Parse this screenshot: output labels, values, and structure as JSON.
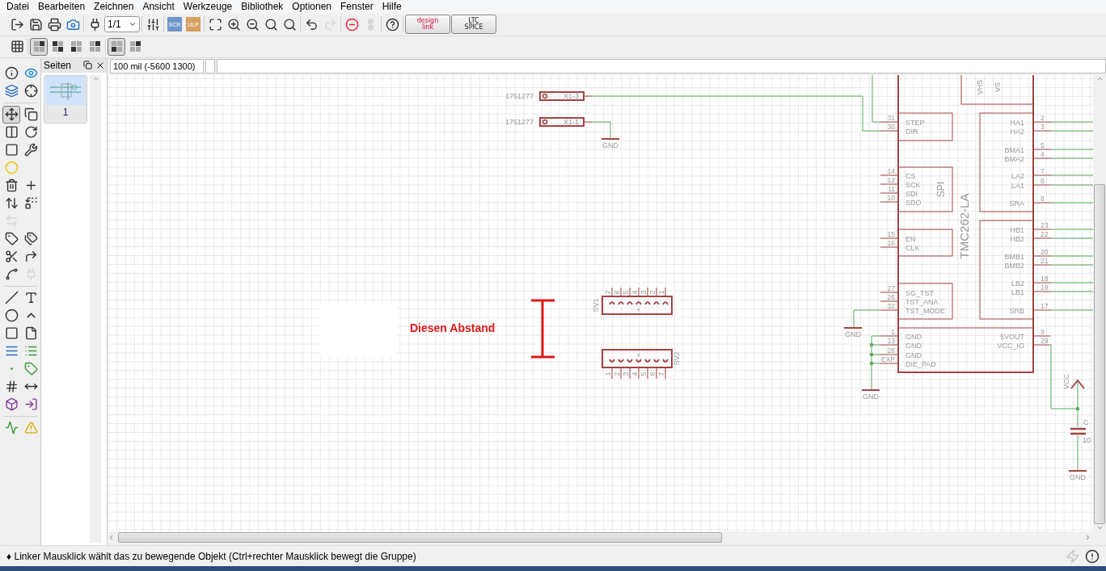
{
  "menu": [
    "Datei",
    "Bearbeiten",
    "Zeichnen",
    "Ansicht",
    "Werkzeuge",
    "Bibliothek",
    "Optionen",
    "Fenster",
    "Hilfe"
  ],
  "toolbar": [
    {
      "kind": "export",
      "disabled": false
    },
    {
      "kind": "save",
      "disabled": false
    },
    {
      "kind": "print",
      "disabled": false
    },
    {
      "kind": "camera",
      "disabled": false
    },
    {
      "kind": "sep"
    },
    {
      "kind": "board",
      "disabled": false
    },
    {
      "kind": "sheet",
      "value": "1/1",
      "disabled": false
    },
    {
      "kind": "sep"
    },
    {
      "kind": "mixer",
      "disabled": false
    },
    {
      "kind": "sep"
    },
    {
      "kind": "script",
      "label": "SCR",
      "disabled": false
    },
    {
      "kind": "ulp",
      "label": "ULP",
      "disabled": false
    },
    {
      "kind": "sep"
    },
    {
      "kind": "zoom-fit",
      "disabled": false
    },
    {
      "kind": "zoom-in",
      "disabled": false
    },
    {
      "kind": "zoom-out",
      "disabled": false
    },
    {
      "kind": "zoom-select",
      "disabled": false
    },
    {
      "kind": "zoom-last",
      "disabled": false
    },
    {
      "kind": "sep"
    },
    {
      "kind": "undo",
      "disabled": false
    },
    {
      "kind": "redo",
      "disabled": true
    },
    {
      "kind": "sep"
    },
    {
      "kind": "stop",
      "disabled": false
    },
    {
      "kind": "go",
      "disabled": true
    },
    {
      "kind": "sep"
    },
    {
      "kind": "help",
      "disabled": false
    },
    {
      "kind": "sep"
    },
    {
      "kind": "designlink",
      "lines": [
        "design",
        "link"
      ],
      "disabled": false
    },
    {
      "kind": "ltspice",
      "lines": [
        "LTC",
        "SPICE"
      ],
      "disabled": false
    }
  ],
  "toolbar2": [
    {
      "kind": "grid",
      "selected": false
    },
    {
      "kind": "sep"
    },
    {
      "kind": "layout",
      "selected": true
    },
    {
      "kind": "layout",
      "selected": false
    },
    {
      "kind": "layout",
      "selected": false
    },
    {
      "kind": "layout",
      "selected": false
    },
    {
      "kind": "sep"
    },
    {
      "kind": "layout",
      "selected": true
    },
    {
      "kind": "layout",
      "selected": false
    }
  ],
  "tool_groups": [
    [
      [
        {
          "kind": "info",
          "selected": false,
          "disabled": false
        },
        {
          "kind": "show",
          "selected": false,
          "disabled": false
        }
      ],
      [
        {
          "kind": "layers",
          "selected": false,
          "disabled": false
        },
        {
          "kind": "mark",
          "selected": false,
          "disabled": false
        }
      ]
    ],
    [
      [
        {
          "kind": "move",
          "selected": true,
          "disabled": false
        },
        {
          "kind": "copy",
          "selected": false,
          "disabled": false
        }
      ],
      [
        {
          "kind": "mirror",
          "selected": false,
          "disabled": false
        },
        {
          "kind": "rotate",
          "selected": false,
          "disabled": false
        }
      ],
      [
        {
          "kind": "group",
          "selected": false,
          "disabled": false
        },
        {
          "kind": "change",
          "selected": false,
          "disabled": false
        }
      ],
      [
        {
          "kind": "paste",
          "selected": false,
          "disabled": false
        }
      ],
      [
        {
          "kind": "delete",
          "selected": false,
          "disabled": false
        },
        {
          "kind": "add",
          "selected": false,
          "disabled": false
        }
      ],
      [
        {
          "kind": "pinswap",
          "selected": false,
          "disabled": false
        },
        {
          "kind": "replace",
          "selected": false,
          "disabled": false
        }
      ],
      [
        {
          "kind": "gateswap",
          "selected": false,
          "disabled": true
        }
      ],
      [
        {
          "kind": "name",
          "selected": false,
          "disabled": false
        },
        {
          "kind": "value",
          "selected": false,
          "disabled": false
        }
      ],
      [
        {
          "kind": "smash",
          "selected": false,
          "disabled": false
        },
        {
          "kind": "miter",
          "selected": false,
          "disabled": false
        }
      ],
      [
        {
          "kind": "split",
          "selected": false,
          "disabled": false
        },
        {
          "kind": "invoke",
          "selected": false,
          "disabled": true
        }
      ]
    ],
    [
      [
        {
          "kind": "wire",
          "selected": false,
          "disabled": false
        },
        {
          "kind": "text",
          "selected": false,
          "disabled": false
        }
      ],
      [
        {
          "kind": "circle",
          "selected": false,
          "disabled": false
        },
        {
          "kind": "arc",
          "selected": false,
          "disabled": false
        }
      ],
      [
        {
          "kind": "rect",
          "selected": false,
          "disabled": false
        },
        {
          "kind": "polygon",
          "selected": false,
          "disabled": false
        }
      ],
      [
        {
          "kind": "bus",
          "selected": false,
          "disabled": false
        },
        {
          "kind": "net",
          "selected": false,
          "disabled": false
        }
      ],
      [
        {
          "kind": "junction",
          "selected": false,
          "disabled": false
        },
        {
          "kind": "label",
          "selected": false,
          "disabled": false
        }
      ],
      [
        {
          "kind": "attribute",
          "selected": false,
          "disabled": false
        },
        {
          "kind": "dimension",
          "selected": false,
          "disabled": false
        }
      ],
      [
        {
          "kind": "module",
          "selected": false,
          "disabled": false
        },
        {
          "kind": "port",
          "selected": false,
          "disabled": false
        }
      ]
    ],
    [
      [
        {
          "kind": "erc",
          "selected": false,
          "disabled": false
        },
        {
          "kind": "errors",
          "selected": false,
          "disabled": false
        }
      ]
    ]
  ],
  "pages_panel": {
    "title": "Seiten",
    "pages": [
      {
        "label": "1",
        "selected": true
      }
    ]
  },
  "coordinates": {
    "value": "100 mil (-5600 1300)"
  },
  "schematic": {
    "annotation": {
      "text": "Diesen Abstand"
    },
    "terminals": [
      {
        "value": "1751277",
        "name": "X1-3"
      },
      {
        "value": "1751277",
        "name": "X1-1"
      }
    ],
    "headers": [
      {
        "name": "SV1",
        "mark": "+",
        "pins": [
          "7",
          "6",
          "5",
          "4",
          "3",
          "2",
          "1"
        ]
      },
      {
        "name": "SV2",
        "mark": "+",
        "pins": [
          "1",
          "2",
          "3",
          "4",
          "5",
          "6",
          "7"
        ]
      }
    ],
    "chip": {
      "name": "TMC262-LA",
      "top_pins": [
        "VHS",
        "VS"
      ],
      "left_groups": [
        {
          "pins": [
            {
              "num": "31",
              "name": "STEP"
            },
            {
              "num": "30",
              "name": "DIR"
            }
          ]
        },
        {
          "label": "SPI",
          "pins": [
            {
              "num": "14",
              "name": "CS"
            },
            {
              "num": "12",
              "name": "SCK"
            },
            {
              "num": "11",
              "name": "SDI"
            },
            {
              "num": "10",
              "name": "SDO"
            }
          ]
        },
        {
          "pins": [
            {
              "num": "15",
              "name": "EN"
            },
            {
              "num": "16",
              "name": "CLK"
            }
          ]
        },
        {
          "pins": [
            {
              "num": "27",
              "name": "SG_TST"
            },
            {
              "num": "26",
              "name": "TST_ANA"
            },
            {
              "num": "32",
              "name": "TST_MODE"
            }
          ]
        }
      ],
      "right_groups": [
        {
          "pins": [
            {
              "num": "2",
              "name": "HA1"
            },
            {
              "num": "3",
              "name": "HA2"
            },
            {
              "num": "5",
              "name": "BMA1"
            },
            {
              "num": "4",
              "name": "BMA2"
            },
            {
              "num": "7",
              "name": "LA2"
            },
            {
              "num": "6",
              "name": "LA1"
            },
            {
              "num": "8",
              "name": "SRA"
            }
          ]
        },
        {
          "pins": [
            {
              "num": "23",
              "name": "HB1"
            },
            {
              "num": "22",
              "name": "HB2"
            },
            {
              "num": "20",
              "name": "BMB1"
            },
            {
              "num": "21",
              "name": "BMB2"
            },
            {
              "num": "18",
              "name": "LB2"
            },
            {
              "num": "19",
              "name": "LB1"
            },
            {
              "num": "17",
              "name": "SRB"
            }
          ]
        }
      ],
      "bottom_left": [
        {
          "num": "1",
          "name": "GND"
        },
        {
          "num": "13",
          "name": "GND"
        },
        {
          "num": "28",
          "name": "GND"
        },
        {
          "num": "EXP",
          "name": "DIE_PAD"
        }
      ],
      "bottom_right": [
        {
          "num": "9",
          "name": "5VOUT"
        },
        {
          "num": "29",
          "name": "VCC_IO"
        }
      ]
    },
    "ground_labels": [
      "GND",
      "GND",
      "GND",
      "GND"
    ],
    "supply_label": "VCC",
    "capacitor": {
      "name": "C",
      "value": "10"
    }
  },
  "status": "♦ Linker Mausklick wählt das zu bewegende Objekt (Ctrl+rechter Mausklick bewegt die Gruppe)"
}
